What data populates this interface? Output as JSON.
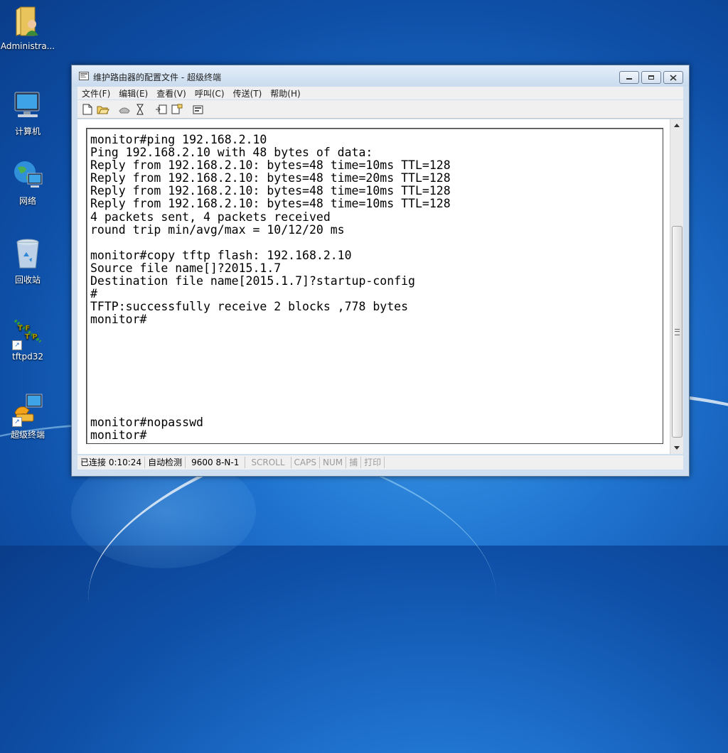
{
  "desktop": {
    "icons": [
      {
        "label": "Administra..."
      },
      {
        "label": "计算机"
      },
      {
        "label": "网络"
      },
      {
        "label": "回收站"
      },
      {
        "label": "tftpd32",
        "logo_text": "TFTP"
      },
      {
        "label": "超级终端"
      }
    ]
  },
  "window": {
    "title": "维护路由器的配置文件 - 超级终端",
    "menu": [
      "文件(F)",
      "编辑(E)",
      "查看(V)",
      "呼叫(C)",
      "传送(T)",
      "帮助(H)"
    ],
    "toolbar_icons": [
      "new-icon",
      "open-icon",
      "disconnect-icon",
      "call-icon",
      "send-icon",
      "receive-icon",
      "properties-icon"
    ],
    "terminal": {
      "lines": [
        "monitor#ping 192.168.2.10",
        "Ping 192.168.2.10 with 48 bytes of data:",
        "Reply from 192.168.2.10: bytes=48 time=10ms TTL=128",
        "Reply from 192.168.2.10: bytes=48 time=20ms TTL=128",
        "Reply from 192.168.2.10: bytes=48 time=10ms TTL=128",
        "Reply from 192.168.2.10: bytes=48 time=10ms TTL=128",
        "4 packets sent, 4 packets received",
        "round trip min/avg/max = 10/12/20 ms",
        "",
        "monitor#copy tftp flash: 192.168.2.10",
        "Source file name[]?2015.1.7",
        "Destination file name[2015.1.7]?startup-config",
        "#",
        "TFTP:successfully receive 2 blocks ,778 bytes",
        "monitor#",
        "",
        "",
        "",
        "",
        "",
        "",
        "",
        "monitor#nopasswd",
        "monitor#"
      ]
    },
    "status": {
      "connected": "已连接 0:10:24",
      "detect": "自动检测",
      "port": "9600 8-N-1",
      "scroll": "SCROLL",
      "caps": "CAPS",
      "num": "NUM",
      "capture": "捕",
      "print": "打印"
    }
  }
}
